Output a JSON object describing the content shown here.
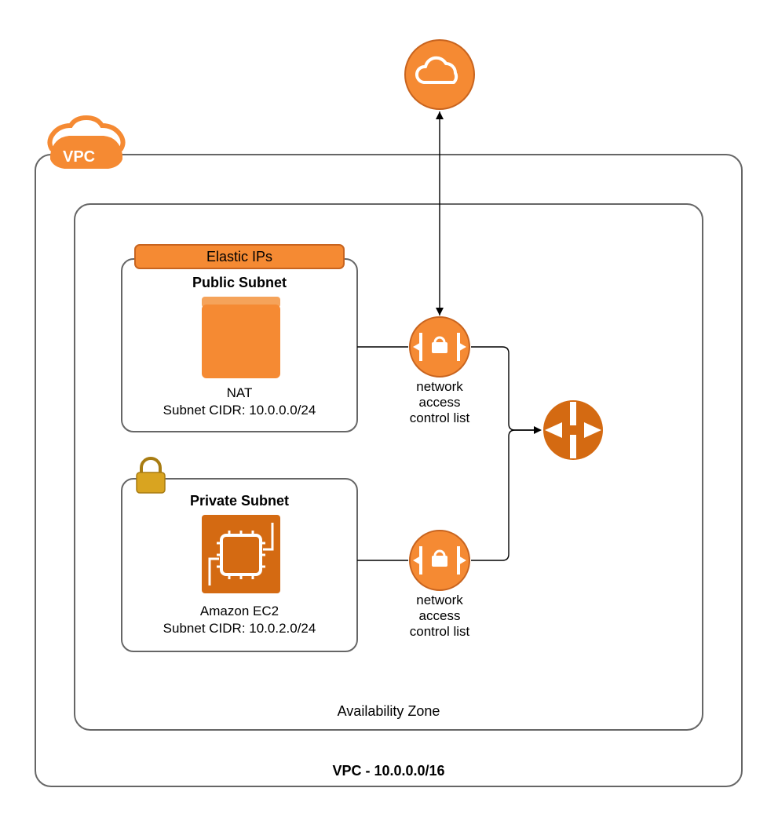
{
  "colors": {
    "orange": "#f58a33",
    "orange_dark": "#d46a12",
    "orange_border": "#c8641f",
    "padlock": "#d9a420"
  },
  "cloud": {
    "label": ""
  },
  "vpc": {
    "badge_text": "VPC",
    "title": "VPC - 10.0.0.0/16"
  },
  "availability_zone": {
    "title": "Availability Zone"
  },
  "public_subnet": {
    "elastic_ip_label": "Elastic IPs",
    "title": "Public Subnet",
    "service": "NAT",
    "cidr": "Subnet CIDR: 10.0.0.0/24"
  },
  "private_subnet": {
    "title": "Private Subnet",
    "service": "Amazon EC2",
    "cidr": "Subnet CIDR: 10.0.2.0/24"
  },
  "nacl1": {
    "line1": "network",
    "line2": "access",
    "line3": "control list"
  },
  "nacl2": {
    "line1": "network",
    "line2": "access",
    "line3": "control list"
  },
  "igw": {
    "label": ""
  }
}
